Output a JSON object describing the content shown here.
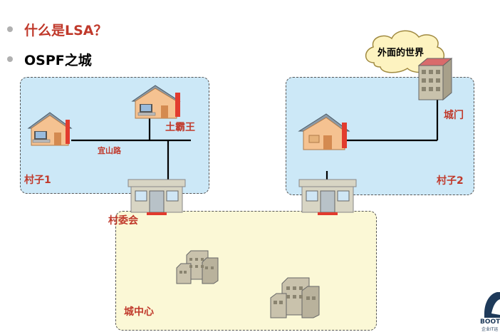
{
  "headings": {
    "question": "什么是LSA？",
    "subtitle": "OSPF之城"
  },
  "colors": {
    "question": "#c0392b",
    "subtitle": "#000000",
    "label": "#c0392b",
    "village_fill": "#cce8f7",
    "city_fill": "#fbf8d6",
    "cloud_fill": "#fdf3c0"
  },
  "labels": {
    "village1": "村子1",
    "village2": "村子2",
    "tubawang": "土霸王",
    "yishanlu": "宜山路",
    "committee": "村委会",
    "citygate": "城门",
    "citycenter": "城中心",
    "outside_world": "外面的世界"
  },
  "logo": {
    "text": "BOOTC",
    "subtext": "企业IT运"
  }
}
